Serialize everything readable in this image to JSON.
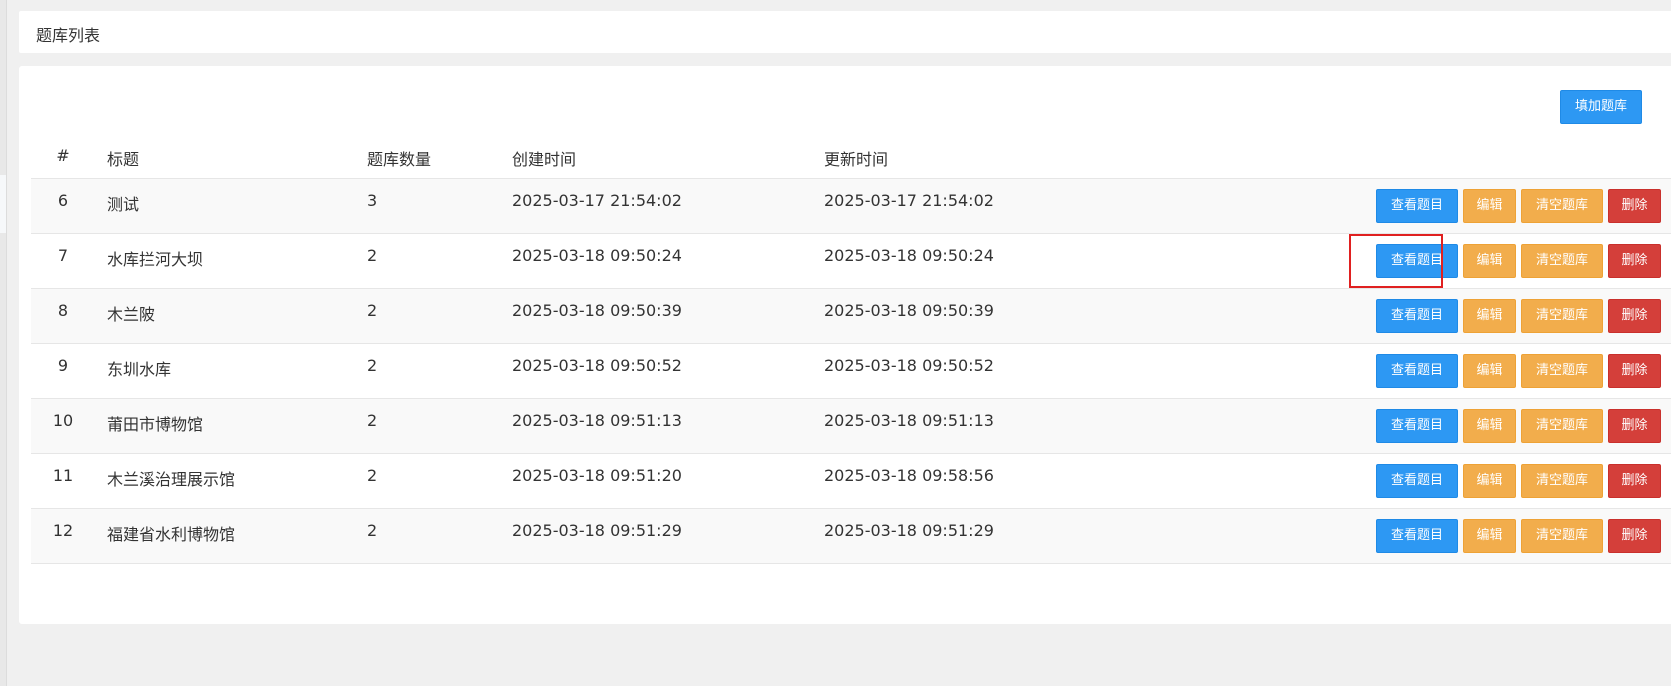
{
  "header": {
    "title": "题库列表"
  },
  "toolbar": {
    "add_label": "填加题库"
  },
  "table": {
    "columns": [
      "#",
      "标题",
      "题库数量",
      "创建时间",
      "更新时间"
    ],
    "rows": [
      {
        "id": "6",
        "title": "测试",
        "count": "3",
        "created": "2025-03-17 21:54:02",
        "updated": "2025-03-17 21:54:02"
      },
      {
        "id": "7",
        "title": "水库拦河大坝",
        "count": "2",
        "created": "2025-03-18 09:50:24",
        "updated": "2025-03-18 09:50:24"
      },
      {
        "id": "8",
        "title": "木兰陂",
        "count": "2",
        "created": "2025-03-18 09:50:39",
        "updated": "2025-03-18 09:50:39"
      },
      {
        "id": "9",
        "title": "东圳水库",
        "count": "2",
        "created": "2025-03-18 09:50:52",
        "updated": "2025-03-18 09:50:52"
      },
      {
        "id": "10",
        "title": "莆田市博物馆",
        "count": "2",
        "created": "2025-03-18 09:51:13",
        "updated": "2025-03-18 09:51:13"
      },
      {
        "id": "11",
        "title": "木兰溪治理展示馆",
        "count": "2",
        "created": "2025-03-18 09:51:20",
        "updated": "2025-03-18 09:58:56"
      },
      {
        "id": "12",
        "title": "福建省水利博物馆",
        "count": "2",
        "created": "2025-03-18 09:51:29",
        "updated": "2025-03-18 09:51:29"
      }
    ],
    "actions": {
      "view": "查看题目",
      "edit": "编辑",
      "clear": "清空题库",
      "delete": "删除"
    }
  },
  "colors": {
    "primary": "#2d98f3",
    "warning": "#f2ad4c",
    "danger": "#d43f3a",
    "highlight_border": "#e02020"
  }
}
